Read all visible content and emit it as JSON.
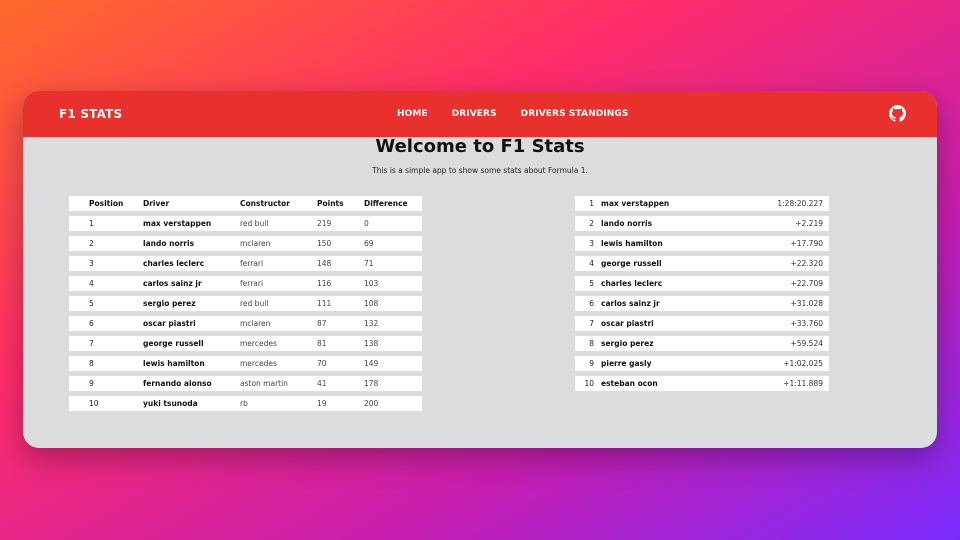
{
  "nav": {
    "brand": "F1 STATS",
    "links": [
      "HOME",
      "DRIVERS",
      "DRIVERS STANDINGS"
    ],
    "github_icon": "github-icon"
  },
  "main": {
    "title": "Welcome to F1 Stats",
    "subtitle": "This is a simple app to show some stats about Formula 1."
  },
  "standings": {
    "headers": [
      "Position",
      "Driver",
      "Constructor",
      "Points",
      "Difference"
    ],
    "rows": [
      [
        "1",
        "max verstappen",
        "red bull",
        "219",
        "0"
      ],
      [
        "2",
        "lando norris",
        "mclaren",
        "150",
        "69"
      ],
      [
        "3",
        "charles leclerc",
        "ferrari",
        "148",
        "71"
      ],
      [
        "4",
        "carlos sainz jr",
        "ferrari",
        "116",
        "103"
      ],
      [
        "5",
        "sergio perez",
        "red bull",
        "111",
        "108"
      ],
      [
        "6",
        "oscar piastri",
        "mclaren",
        "87",
        "132"
      ],
      [
        "7",
        "george russell",
        "mercedes",
        "81",
        "138"
      ],
      [
        "8",
        "lewis hamilton",
        "mercedes",
        "70",
        "149"
      ],
      [
        "9",
        "fernando alonso",
        "aston martin",
        "41",
        "178"
      ],
      [
        "10",
        "yuki tsunoda",
        "rb",
        "19",
        "200"
      ]
    ]
  },
  "race": {
    "rows": [
      [
        "1",
        "max verstappen",
        "1:28:20.227"
      ],
      [
        "2",
        "lando norris",
        "+2.219"
      ],
      [
        "3",
        "lewis hamilton",
        "+17.790"
      ],
      [
        "4",
        "george russell",
        "+22.320"
      ],
      [
        "5",
        "charles leclerc",
        "+22.709"
      ],
      [
        "6",
        "carlos sainz jr",
        "+31.028"
      ],
      [
        "7",
        "oscar piastri",
        "+33.760"
      ],
      [
        "8",
        "sergio perez",
        "+59.524"
      ],
      [
        "9",
        "pierre gasly",
        "+1:02.025"
      ],
      [
        "10",
        "esteban ocon",
        "+1:11.889"
      ]
    ]
  }
}
